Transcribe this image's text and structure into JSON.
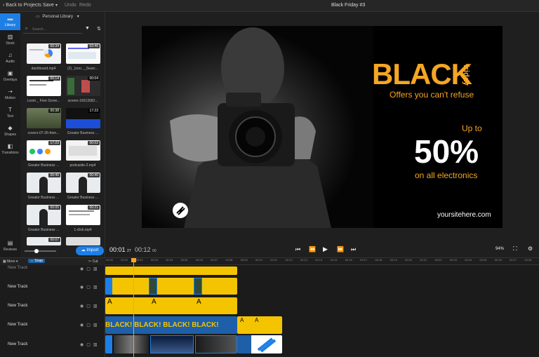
{
  "topbar": {
    "back": "Back to Projects",
    "save": "Save",
    "undo": "Undo",
    "redo": "Redo",
    "title": "Black Friday #3"
  },
  "rail": [
    {
      "label": "Library",
      "icon": "folder-icon"
    },
    {
      "label": "Stock",
      "icon": "books-icon"
    },
    {
      "label": "Audio",
      "icon": "music-icon"
    },
    {
      "label": "Overlays",
      "icon": "image-icon"
    },
    {
      "label": "Motion",
      "icon": "motion-icon"
    },
    {
      "label": "Text",
      "icon": "text-icon"
    },
    {
      "label": "Shapes",
      "icon": "shapes-icon"
    },
    {
      "label": "Transitions",
      "icon": "transitions-icon"
    },
    {
      "label": "Reviews",
      "icon": "chat-icon"
    }
  ],
  "library": {
    "dropdown": "Personal Library",
    "search_placeholder": "Search...",
    "import": "Import",
    "items": [
      {
        "name": "dashboard.mp4",
        "duration": "00:34"
      },
      {
        "name": "(2) _looo..._Searc...",
        "duration": "03:46"
      },
      {
        "name": "Loom _ Free Scree...",
        "duration": "00:14"
      },
      {
        "name": "screen-16013582...",
        "duration": "00:04"
      },
      {
        "name": "covers-07-26-frien...",
        "duration": "00:38"
      },
      {
        "name": "Greator Business ...",
        "duration": "17:23"
      },
      {
        "name": "Greator Business ...",
        "duration": "17:23"
      },
      {
        "name": "podcastle-2.mp4",
        "duration": "00:02"
      },
      {
        "name": "Greator Business ...",
        "duration": "00:40"
      },
      {
        "name": "Greator Business ...",
        "duration": "00:40"
      },
      {
        "name": "Greator Business ...",
        "duration": "00:05"
      },
      {
        "name": "1-click.mp4",
        "duration": "00:21"
      },
      {
        "name": "",
        "duration": "00:07"
      },
      {
        "name": "",
        "duration": ""
      }
    ]
  },
  "preview": {
    "black": "BLACK",
    "friday": "friday",
    "offers": "Offers you can't refuse",
    "upto": "Up to",
    "percent": "50%",
    "electronics": "on all electronics",
    "site": "yoursitehere.com"
  },
  "controls": {
    "current": "00:01",
    "current_frames": "27",
    "total": "00:12",
    "total_frames": "00",
    "zoom": "94%"
  },
  "timeline": {
    "more": "More",
    "snap": "Snap",
    "cut": "Cut",
    "tracks": [
      "New Track",
      "New Track",
      "New Track",
      "New Track",
      "New Track"
    ],
    "ticks": [
      "00:00",
      "00:01",
      "00:02",
      "00:03",
      "00:04",
      "00:05",
      "00:06",
      "00:07",
      "00:08",
      "00:09",
      "00:10",
      "00:11",
      "00:12",
      "00:13",
      "00:14",
      "00:15",
      "00:16",
      "00:17",
      "00:18",
      "00:19",
      "00:20",
      "00:21",
      "00:22",
      "00:23",
      "00:24",
      "00:25",
      "00:26",
      "00:27",
      "00:28"
    ],
    "text_clip_letter": "A",
    "strip_text": "BLACK! BLACK! BLACK! BLACK!"
  },
  "colors": {
    "accent": "#1d7fe6",
    "clip_yellow": "#f5c400",
    "brand_orange": "#f5a623"
  }
}
